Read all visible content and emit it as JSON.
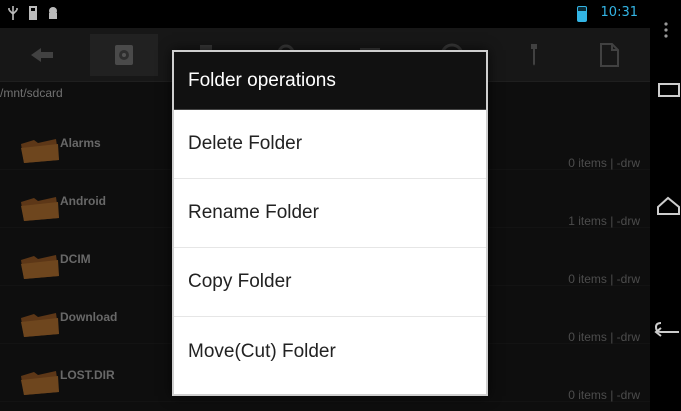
{
  "status_bar": {
    "time": "10:31",
    "left_icons": [
      "usb-icon",
      "sd-card-icon",
      "android-debug-icon"
    ],
    "accent": "#33b5e5"
  },
  "toolbar": {
    "buttons": [
      {
        "icon": "back-arrow-icon"
      },
      {
        "icon": "sdcard-home-icon",
        "selected": true
      },
      {
        "icon": "bookmark-icon"
      },
      {
        "icon": "search-icon"
      },
      {
        "icon": "multi-select-icon"
      },
      {
        "icon": "info-icon"
      },
      {
        "icon": "tools-icon"
      },
      {
        "icon": "new-file-icon"
      }
    ]
  },
  "path": "/mnt/sdcard",
  "files": [
    {
      "name": "Alarms",
      "meta": "0 items | -drw"
    },
    {
      "name": "Android",
      "meta": "1 items | -drw"
    },
    {
      "name": "DCIM",
      "meta": "0 items | -drw"
    },
    {
      "name": "Download",
      "meta": "0 items | -drw"
    },
    {
      "name": "LOST.DIR",
      "meta": "0 items | -drw"
    }
  ],
  "dialog": {
    "title": "Folder operations",
    "options": [
      "Delete Folder",
      "Rename Folder",
      "Copy Folder",
      "Move(Cut) Folder"
    ]
  },
  "nav_bar": {
    "buttons": [
      "menu-icon",
      "recent-apps-icon",
      "home-icon",
      "back-icon"
    ]
  }
}
